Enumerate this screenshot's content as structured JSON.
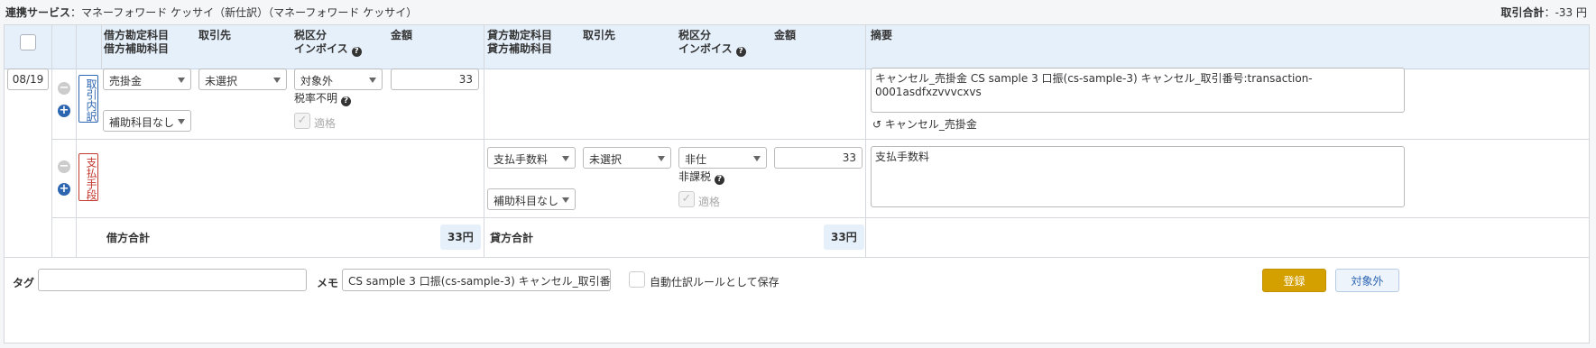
{
  "top": {
    "service_label": "連携サービス",
    "service_value": "マネーフォワード ケッサイ（新仕訳）（マネーフォワード ケッサイ）",
    "total_label": "取引合計",
    "total_value": "-33 円"
  },
  "header": {
    "debit_account": "借方勘定科目",
    "debit_sub": "借方補助科目",
    "debit_partner": "取引先",
    "debit_tax": "税区分",
    "debit_invoice": "インボイス",
    "debit_amount": "金額",
    "credit_account": "貸方勘定科目",
    "credit_sub": "貸方補助科目",
    "credit_partner": "取引先",
    "credit_tax": "税区分",
    "credit_invoice": "インボイス",
    "credit_amount": "金額",
    "memo": "摘要"
  },
  "row1": {
    "date": "08/19",
    "tag_label": "取引内訳",
    "account": "売掛金",
    "partner": "未選択",
    "tax": "対象外",
    "amount": "33",
    "tax_rate_note": "税率不明",
    "sub_account": "補助科目なし",
    "qualified_label": "適格",
    "description": "キャンセル_売掛金 CS sample 3 口振(cs-sample-3) キャンセル_取引番号:transaction-0001asdfxzvvvcxvs",
    "undo_label": "キャンセル_売掛金"
  },
  "row2": {
    "tag_label": "支払手段",
    "account": "支払手数料",
    "partner": "未選択",
    "tax": "非仕",
    "amount": "33",
    "tax_note": "非課税",
    "sub_account": "補助科目なし",
    "qualified_label": "適格",
    "description": "支払手数料"
  },
  "totals": {
    "debit_label": "借方合計",
    "debit_value": "33円",
    "credit_label": "貸方合計",
    "credit_value": "33円"
  },
  "footer": {
    "tag_label": "タグ",
    "tag_value": "",
    "memo_label": "メモ",
    "memo_value": "CS sample 3 口振(cs-sample-3) キャンセル_取引番",
    "auto_rule_label": "自動仕訳ルールとして保存",
    "register_button": "登録",
    "exclude_button": "対象外"
  },
  "colors": {
    "header_bg": "#e6f0fb",
    "primary_button": "#d4a000",
    "blue_accent": "#2d66b0",
    "red_accent": "#c43a31"
  }
}
